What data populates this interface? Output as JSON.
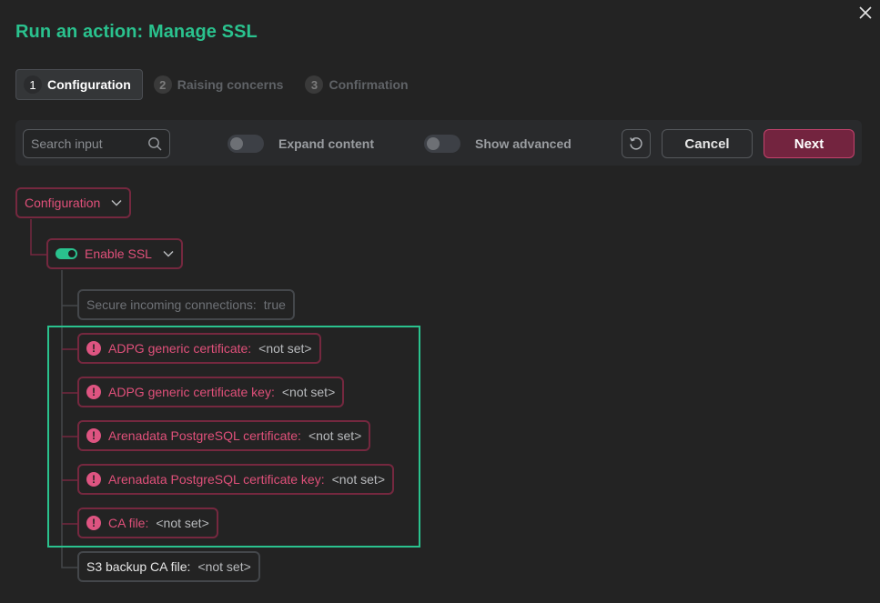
{
  "dialog": {
    "title": "Run an action: Manage SSL",
    "close_icon": "close-icon"
  },
  "steps": [
    {
      "number": "1",
      "label": "Configuration",
      "active": true
    },
    {
      "number": "2",
      "label": "Raising concerns",
      "active": false
    },
    {
      "number": "3",
      "label": "Confirmation",
      "active": false
    }
  ],
  "toolbar": {
    "search_placeholder": "Search input",
    "search_icon": "search-icon",
    "expand_label": "Expand content",
    "expand_on": false,
    "advanced_label": "Show advanced",
    "advanced_on": false,
    "reset_icon": "reset-icon",
    "cancel_label": "Cancel",
    "next_label": "Next"
  },
  "tree": {
    "root_label": "Configuration",
    "group_label": "Enable SSL",
    "group_enabled": true,
    "items": [
      {
        "label": "Secure incoming connections:",
        "value": "true",
        "state": "disabled"
      },
      {
        "label": "ADPG generic certificate:",
        "value": "<not set>",
        "state": "error"
      },
      {
        "label": "ADPG generic certificate key:",
        "value": "<not set>",
        "state": "error"
      },
      {
        "label": "Arenadata PostgreSQL certificate:",
        "value": "<not set>",
        "state": "error"
      },
      {
        "label": "Arenadata PostgreSQL certificate key:",
        "value": "<not set>",
        "state": "error"
      },
      {
        "label": "CA file:",
        "value": "<not set>",
        "state": "error"
      },
      {
        "label": "S3 backup CA file:",
        "value": "<not set>",
        "state": "normal"
      }
    ]
  },
  "colors": {
    "accent": "#2ac28e",
    "error": "#e0507a",
    "primary_button": "#73243f",
    "background": "#232323"
  }
}
